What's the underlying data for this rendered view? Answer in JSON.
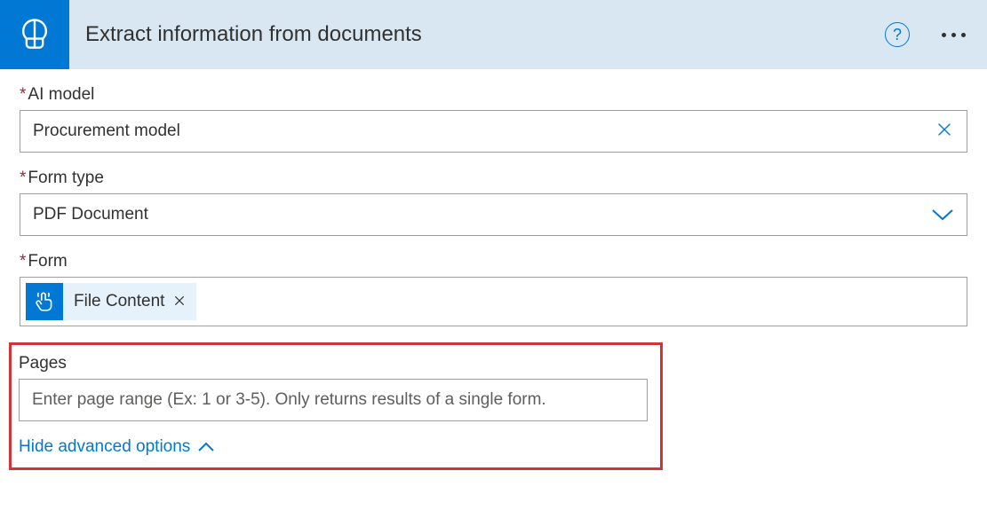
{
  "header": {
    "title": "Extract information from documents"
  },
  "fields": {
    "ai_model": {
      "label": "AI model",
      "value": "Procurement model"
    },
    "form_type": {
      "label": "Form type",
      "value": "PDF Document"
    },
    "form": {
      "label": "Form",
      "token": "File Content"
    },
    "pages": {
      "label": "Pages",
      "placeholder": "Enter page range (Ex: 1 or 3-5). Only returns results of a single form."
    }
  },
  "advanced_toggle": "Hide advanced options"
}
